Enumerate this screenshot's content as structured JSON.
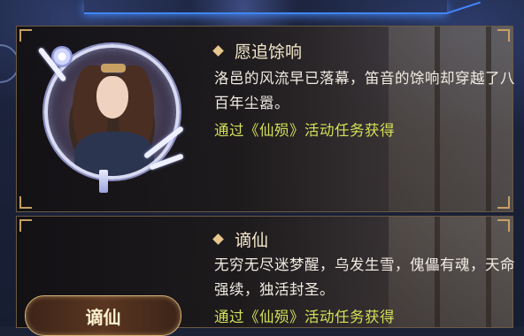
{
  "cards": [
    {
      "title": "愿追馀响",
      "description": "洛邑的风流早已落幕，笛音的馀响却穿越了八百年尘嚣。",
      "source": "通过《仙殒》活动任务获得"
    },
    {
      "title": "谪仙",
      "description": "无穷无尽迷梦醒，乌发生雪，傀儡有魂，天命强续，独活封圣。",
      "source": "通过《仙殒》活动任务获得",
      "name_plate": "谪仙"
    }
  ],
  "colors": {
    "source_text": "#d3e157",
    "title_text": "#f3e6c8",
    "accent_gold": "#c7a064",
    "top_glow": "#3f86ff"
  },
  "icons": [
    "diamond-bullet-icon",
    "portrait-frame",
    "bone-flute-ornament"
  ]
}
